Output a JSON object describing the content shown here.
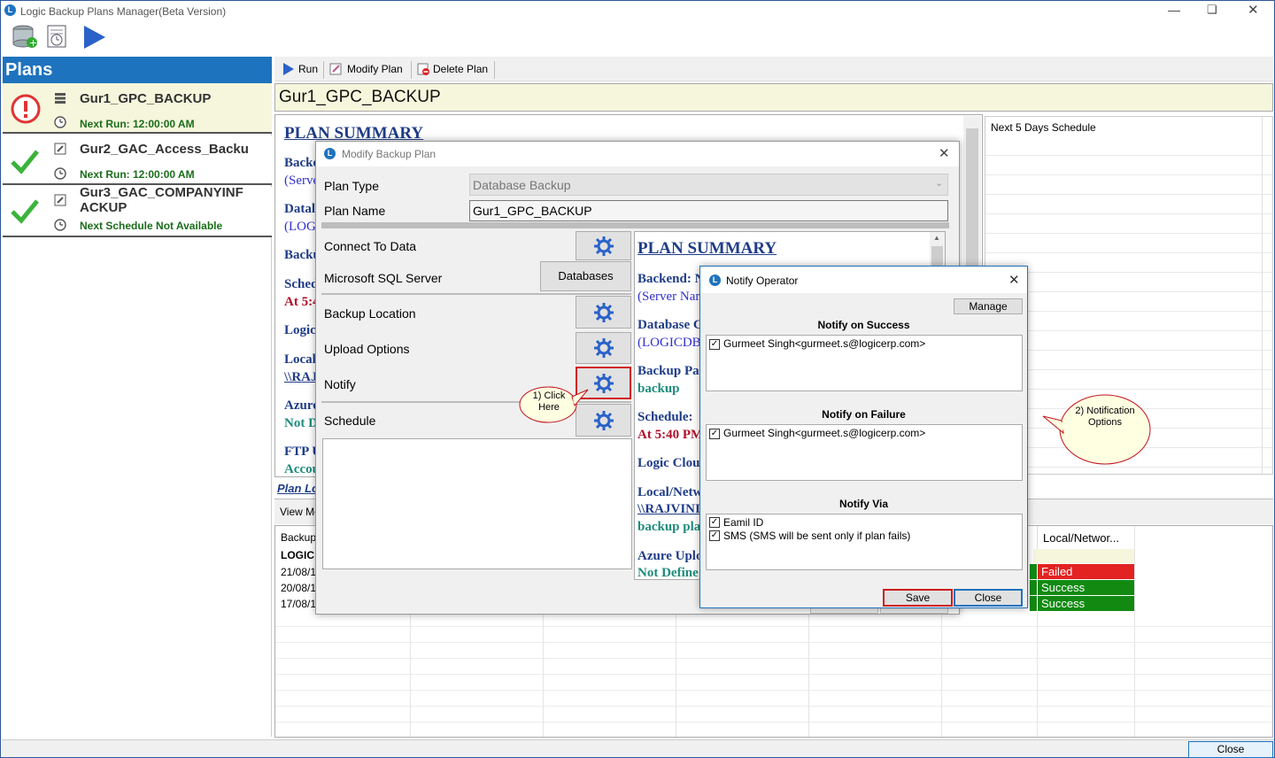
{
  "window": {
    "title": "Logic Backup Plans Manager(Beta Version)"
  },
  "sidebar": {
    "title": "Plans",
    "plans": [
      {
        "name": "Gur1_GPC_BACKUP",
        "next_run": "Next Run: 12:00:00 AM",
        "status": "error"
      },
      {
        "name": "Gur2_GAC_Access_Backu",
        "next_run": "Next Run: 12:00:00 AM",
        "status": "success"
      },
      {
        "name_line1": "Gur3_GAC_COMPANYINF",
        "name_line2": "ACKUP",
        "next_run": "Next Schedule Not Available",
        "status": "success"
      }
    ]
  },
  "toolbar": {
    "run": "Run",
    "modify": "Modify Plan",
    "delete": "Delete Plan"
  },
  "selected_plan": "Gur1_GPC_BACKUP",
  "summary_bg": {
    "heading": "PLAN SUMMARY",
    "lines": [
      "Backe",
      "(Serve",
      "Datal",
      "(LOG",
      "Backu",
      "Sched",
      "At 5:4",
      "Logic",
      "Local",
      "\\\\RAJ",
      "Azure",
      "Not D",
      "FTP U",
      "Accou"
    ]
  },
  "right_panel": {
    "title": "Next 5 Days Schedule"
  },
  "plan_log": {
    "link": "Plan Lo",
    "view": "View Mo",
    "header": "Backup",
    "group": "LOGIC",
    "dates": [
      "21/08/1",
      "20/08/1",
      "17/08/1"
    ],
    "local_header": "Local/Networ...",
    "statuses": [
      "Failed",
      "Success",
      "Success"
    ]
  },
  "bottom": {
    "close": "Close"
  },
  "modify_dialog": {
    "title": "Modify Backup Plan",
    "plan_type_label": "Plan Type",
    "plan_type_value": "Database Backup",
    "plan_name_label": "Plan Name",
    "plan_name_value": "Gur1_GPC_BACKUP",
    "connect": "Connect To Data",
    "sql_server": "Microsoft SQL Server",
    "databases": "Databases",
    "backup_location": "Backup Location",
    "upload_options": "Upload Options",
    "notify": "Notify",
    "schedule": "Schedule",
    "summary": {
      "heading": "PLAN SUMMARY",
      "backend": "Backend: N",
      "server": "(Server Nar",
      "database": "Database C",
      "logicdb": "(LOGICDB",
      "backup_path": "Backup Pa",
      "backup": "backup",
      "schedule": "Schedule:",
      "at": "At 5:40 PM",
      "logic_cloud": "Logic Clou",
      "local_net": "Local/Netw",
      "rajvin": "\\\\RAJVINI",
      "backup_plan": "backup pla",
      "azure": "Azure Uplo",
      "not_defined": "Not Define"
    }
  },
  "callouts": {
    "click_here": "1) Click Here",
    "notification_options": "2) Notification Options"
  },
  "notify_dialog": {
    "title": "Notify Operator",
    "manage": "Manage",
    "success_title": "Notify on Success",
    "success_item": "Gurmeet Singh<gurmeet.s@logicerp.com>",
    "failure_title": "Notify on Failure",
    "failure_item": "Gurmeet Singh<gurmeet.s@logicerp.com>",
    "via_title": "Notify Via",
    "via_email": "Eamil ID",
    "via_sms": "SMS (SMS will be sent only if plan fails)",
    "save": "Save",
    "close": "Close"
  }
}
